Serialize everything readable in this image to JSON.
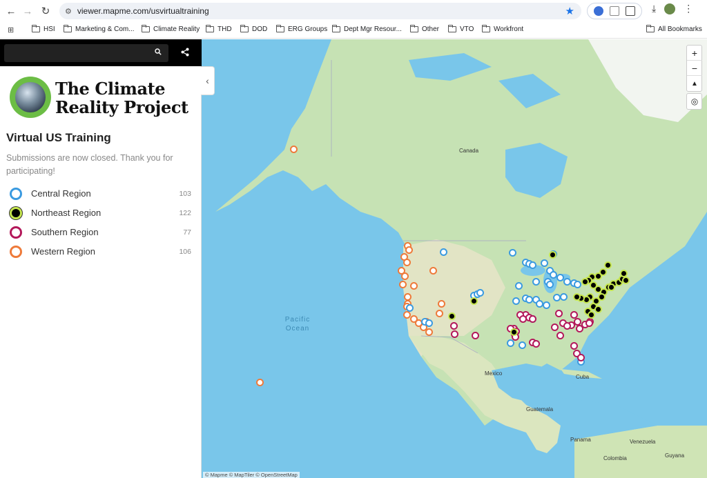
{
  "browser": {
    "url": "viewer.mapme.com/usvirtualtraining",
    "bookmarks": [
      "HSI",
      "Marketing & Com...",
      "Climate Reality",
      "THD",
      "DOD",
      "ERG Groups",
      "Dept Mgr Resour...",
      "Other",
      "VTO",
      "Workfront"
    ],
    "all_bookmarks": "All Bookmarks"
  },
  "sidebar": {
    "search_placeholder": "",
    "logo_line1": "The Climate",
    "logo_line2": "Reality Project",
    "title": "Virtual US Training",
    "subtitle": "Submissions are now closed. Thank you for participating!",
    "legend": [
      {
        "label": "Central Region",
        "count": "103",
        "color": "#3a9ae0"
      },
      {
        "label": "Northeast Region",
        "count": "122",
        "color": "#c5e54e"
      },
      {
        "label": "Southern Region",
        "count": "77",
        "color": "#b3185a"
      },
      {
        "label": "Western Region",
        "count": "106",
        "color": "#ee7a3a"
      }
    ]
  },
  "map": {
    "labels": {
      "canada": "Canada",
      "pacific": "Pacific Ocean",
      "mexico": "Mexico",
      "cuba": "Cuba",
      "guatemala": "Guatemala",
      "panama": "Panama",
      "venezuela": "Venezuela",
      "colombia": "Colombia",
      "guyana": "Guyana"
    },
    "attribution": "© Mapme  © MapTiler  © OpenStreetMap"
  }
}
